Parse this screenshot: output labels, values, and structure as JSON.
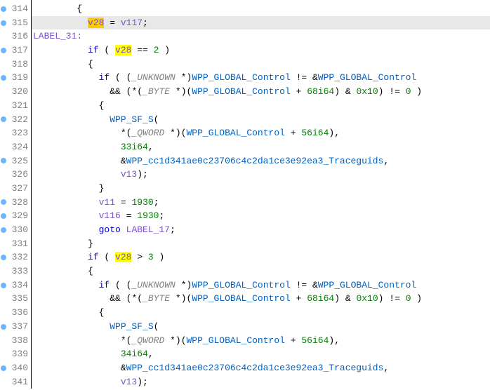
{
  "first_line": 314,
  "current_line": 315,
  "dotted_lines": [
    314,
    315,
    317,
    319,
    322,
    325,
    328,
    329,
    330,
    332,
    334,
    337,
    340
  ],
  "tokens": {
    "if": "if",
    "goto": "goto",
    "v28": "v28",
    "v117": "v117",
    "v13": "v13",
    "v11": "v11",
    "v116": "v116",
    "UNKNOWN": "_UNKNOWN",
    "BYTE": "_BYTE",
    "QWORD": "_QWORD",
    "LABEL_31": "LABEL_31:",
    "LABEL_17": "LABEL_17",
    "WGC": "WPP_GLOBAL_Control",
    "WSFS": "WPP_SF_S",
    "trace": "WPP_cc1d341ae0c23706c4c2da1ce3e92ea3_Traceguids",
    "n2": "2",
    "n3": "3",
    "n0": "0",
    "n68": "68i64",
    "n56": "56i64",
    "n33": "33i64",
    "n34": "34i64",
    "n1930": "1930",
    "hx10": "0x10",
    "eq": "==",
    "ne": "!=",
    "gt": ">",
    "assign": "=",
    "amp": "&",
    "star": "*",
    "and": "&&",
    "plus": "+"
  },
  "chart_data": null
}
